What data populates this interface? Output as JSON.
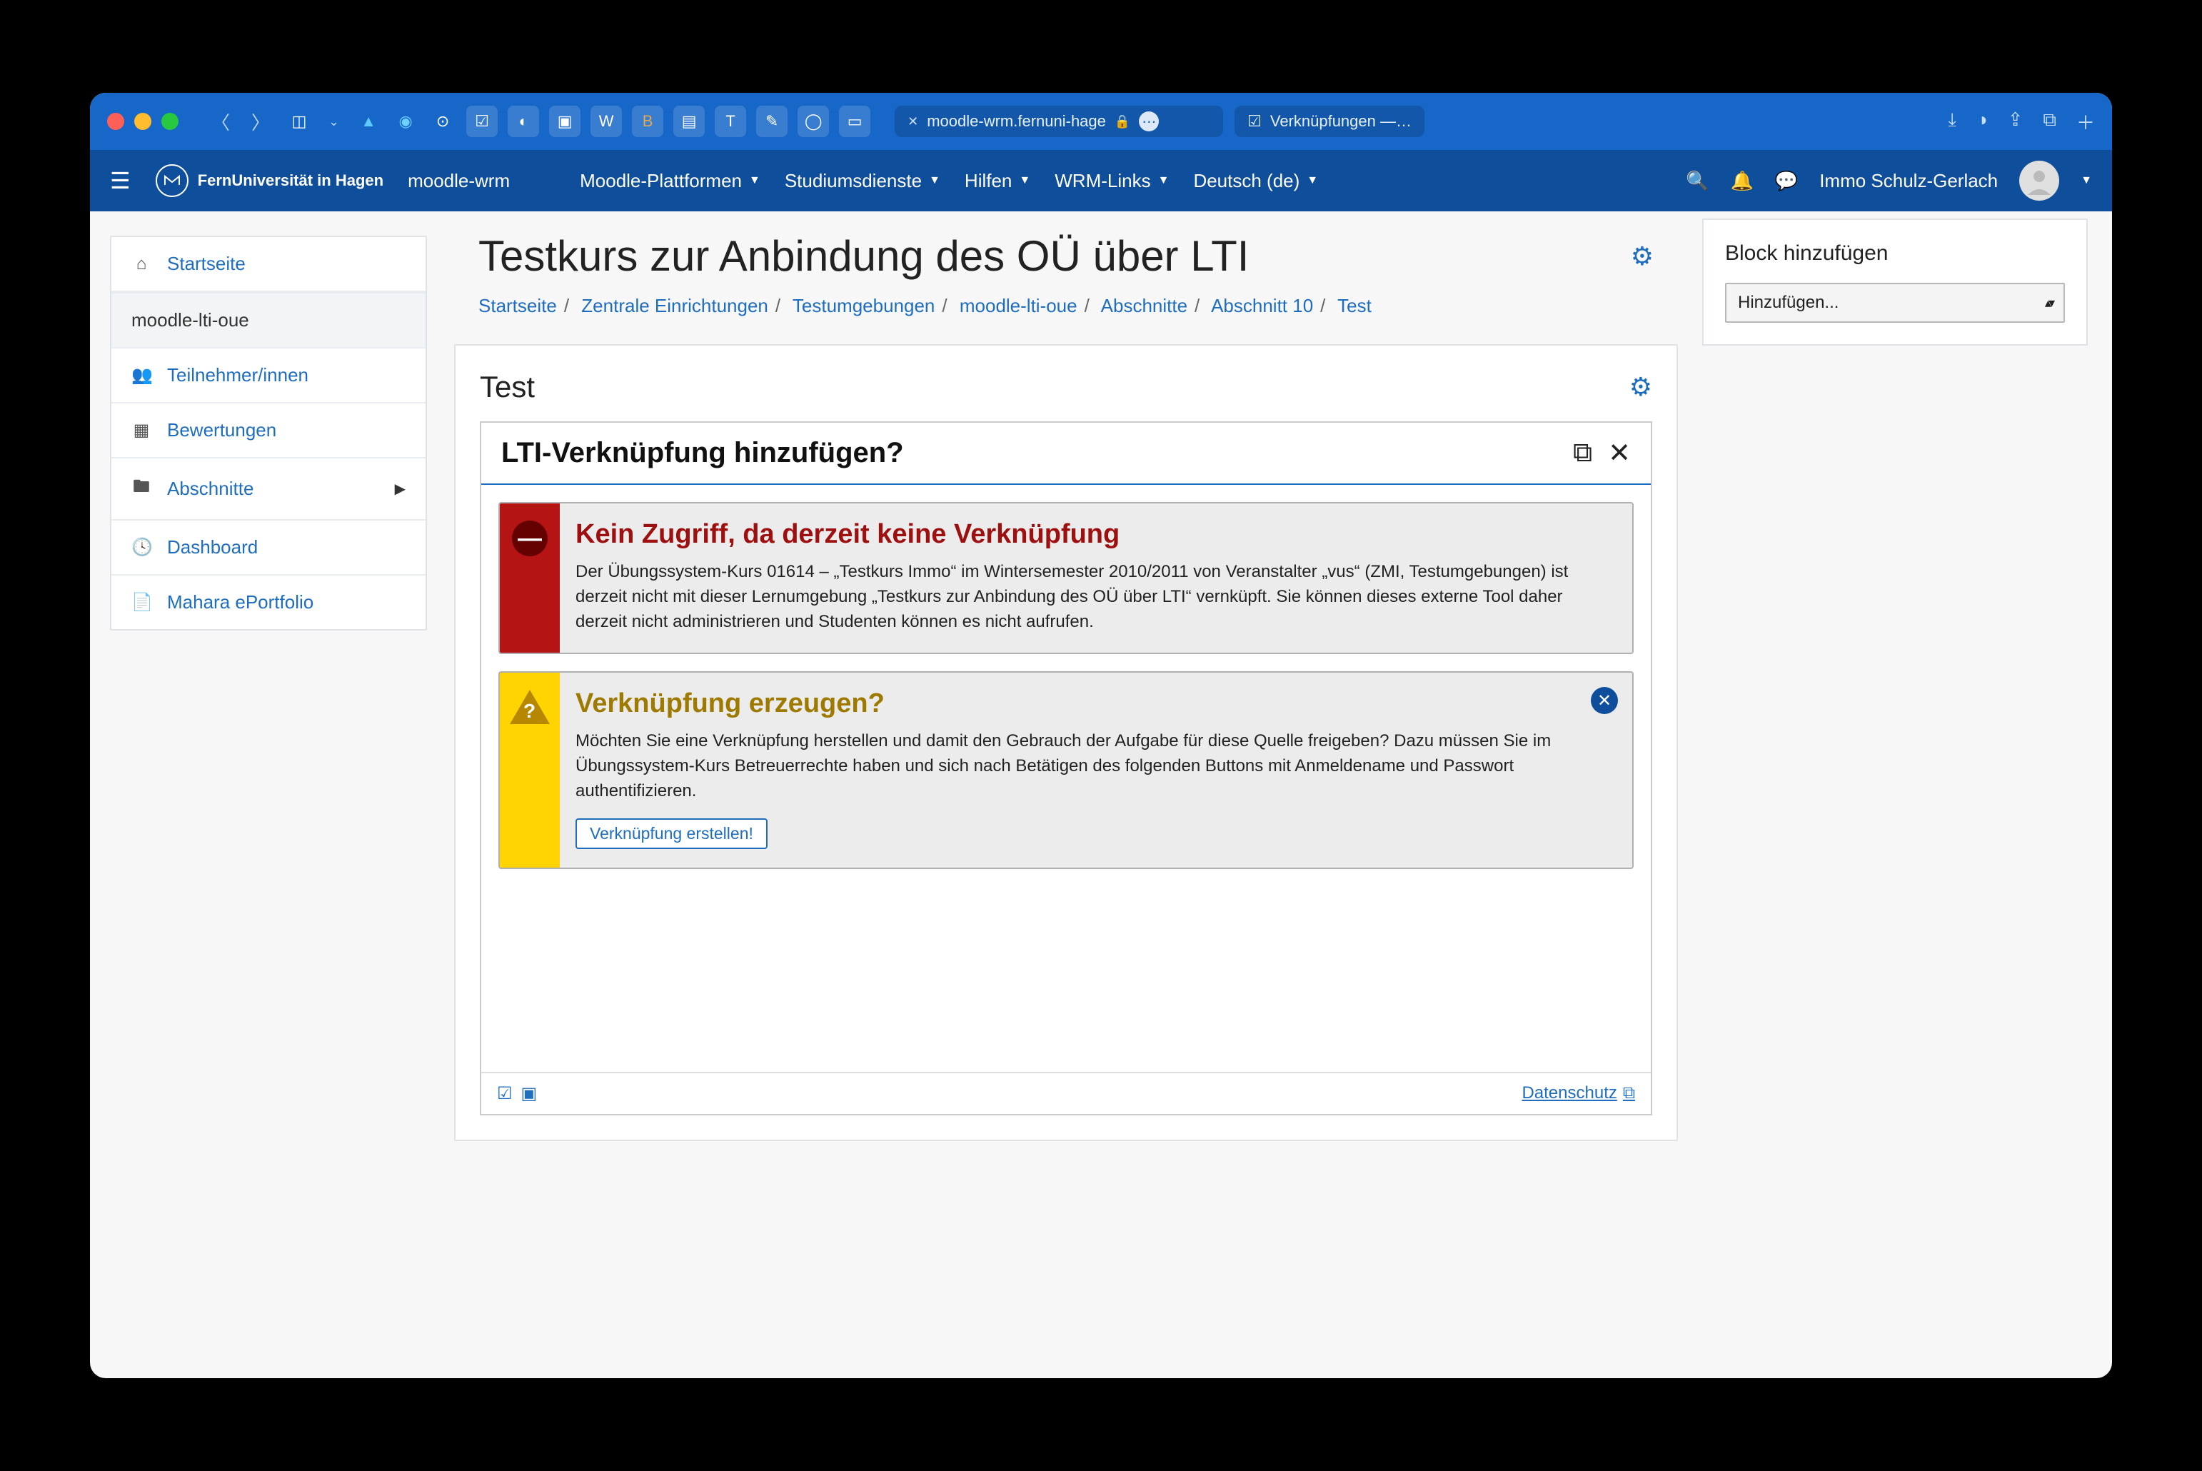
{
  "browser": {
    "tabs": [
      {
        "label": "moodle-wrm.fernuni-hage",
        "active": true,
        "locked": true
      },
      {
        "label": "Verknüpfungen —…",
        "active": false
      }
    ]
  },
  "nav": {
    "site_name": "FernUniversität in Hagen",
    "course_short": "moodle-wrm",
    "links": [
      "Moodle-Plattformen",
      "Studiumsdienste",
      "Hilfen",
      "WRM-Links",
      "Deutsch (de)"
    ],
    "user": "Immo Schulz-Gerlach"
  },
  "sidebar": {
    "items": [
      {
        "icon": "home",
        "label": "Startseite"
      },
      {
        "icon": "",
        "label": "moodle-lti-oue",
        "active": true
      },
      {
        "icon": "users",
        "label": "Teilnehmer/innen"
      },
      {
        "icon": "table",
        "label": "Bewertungen"
      },
      {
        "icon": "folder",
        "label": "Abschnitte",
        "sub": true
      },
      {
        "icon": "tacho",
        "label": "Dashboard"
      },
      {
        "icon": "doc",
        "label": "Mahara ePortfolio"
      }
    ]
  },
  "page": {
    "title": "Testkurs zur Anbindung des OÜ über LTI",
    "breadcrumb": [
      "Startseite",
      "Zentrale Einrichtungen",
      "Testumgebungen",
      "moodle-lti-oue",
      "Abschnitte",
      "Abschnitt 10",
      "Test"
    ],
    "section_title": "Test"
  },
  "lti": {
    "header": "LTI-Verknüpfung hinzufügen?",
    "error": {
      "title": "Kein Zugriff, da derzeit keine Verknüpfung",
      "body": "Der Übungssystem-Kurs 01614 – „Testkurs Immo“ im Wintersemester 2010/2011 von Veranstalter „vus“ (ZMI, Testumgebungen) ist derzeit nicht mit dieser Lernumgebung „Testkurs zur Anbindung des OÜ über LTI“ vernküpft. Sie können dieses externe Tool daher derzeit nicht administrieren und Studenten können es nicht aufrufen."
    },
    "warn": {
      "title": "Verknüpfung erzeugen?",
      "body": "Möchten Sie eine Verknüpfung herstellen und damit den Gebrauch der Aufgabe für diese Quelle freigeben? Dazu müssen Sie im Übungssystem-Kurs Betreuerrechte haben und sich nach Betätigen des folgenden Buttons mit Anmeldename und Passwort authentifizieren.",
      "button": "Verknüpfung erstellen!"
    },
    "footer_link": "Datenschutz"
  },
  "aside": {
    "title": "Block hinzufügen",
    "select": "Hinzufügen..."
  }
}
